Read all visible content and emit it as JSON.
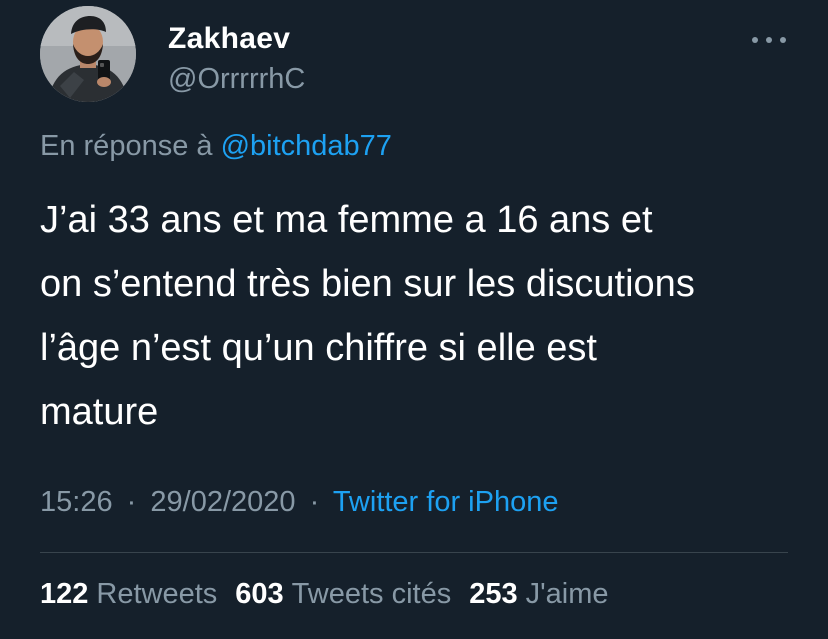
{
  "user": {
    "display_name": "Zakhaev",
    "handle": "@OrrrrrhC"
  },
  "more_button": {
    "icon": "more-horizontal-icon"
  },
  "reply": {
    "prefix": "En réponse à",
    "mention": "@bitchdab77"
  },
  "tweet": {
    "lines": [
      "J’ai 33 ans et ma femme a 16 ans et",
      "on s’entend très bien sur les discutions",
      "l’âge n’est qu’un chiffre si elle est",
      "mature"
    ]
  },
  "meta": {
    "time": "15:26",
    "separator": "·",
    "date": "29/02/2020",
    "source": "Twitter for iPhone"
  },
  "stats": {
    "retweets_count": "122",
    "retweets_label": "Retweets",
    "quotes_count": "603",
    "quotes_label": "Tweets cités",
    "likes_count": "253",
    "likes_label": "J'aime"
  },
  "colors": {
    "background": "#15202b",
    "primary_text": "#ffffff",
    "secondary_text": "#8899a6",
    "link": "#1da1f2",
    "divider": "#38444d"
  }
}
